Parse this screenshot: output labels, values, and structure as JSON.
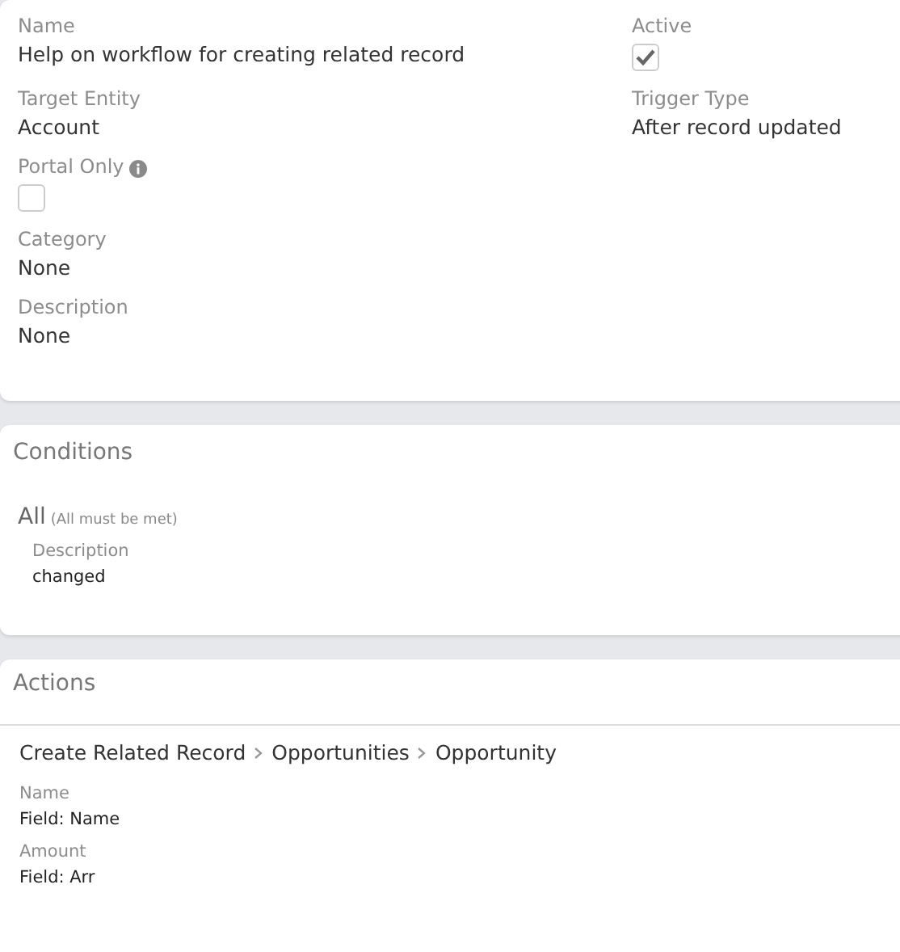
{
  "details": {
    "rows": [
      {
        "fields": [
          {
            "label": "Name",
            "kind": "text",
            "value": "Help on workflow for creating related record"
          },
          {
            "label": "Active",
            "kind": "checkbox",
            "checked": true
          }
        ]
      },
      {
        "fields": [
          {
            "label": "Target Entity",
            "kind": "text",
            "value": "Account"
          },
          {
            "label": "Trigger Type",
            "kind": "text",
            "value": "After record updated"
          }
        ]
      },
      {
        "fields": [
          {
            "label": "Portal Only",
            "kind": "checkbox",
            "checked": false,
            "info": true
          }
        ]
      },
      {
        "fields": [
          {
            "label": "Category",
            "kind": "text",
            "value": "None"
          }
        ]
      },
      {
        "fields": [
          {
            "label": "Description",
            "kind": "text",
            "value": "None"
          }
        ]
      }
    ]
  },
  "conditions": {
    "title": "Conditions",
    "group": {
      "type": "All",
      "note": "(All must be met)"
    },
    "items": [
      {
        "field": "Description",
        "value": "changed"
      }
    ]
  },
  "actions": {
    "title": "Actions",
    "items": [
      {
        "path": [
          "Create Related Record",
          "Opportunities",
          "Opportunity"
        ],
        "fields": [
          {
            "label": "Name",
            "value": "Field: Name"
          },
          {
            "label": "Amount",
            "value": "Field: Arr"
          }
        ]
      }
    ]
  }
}
